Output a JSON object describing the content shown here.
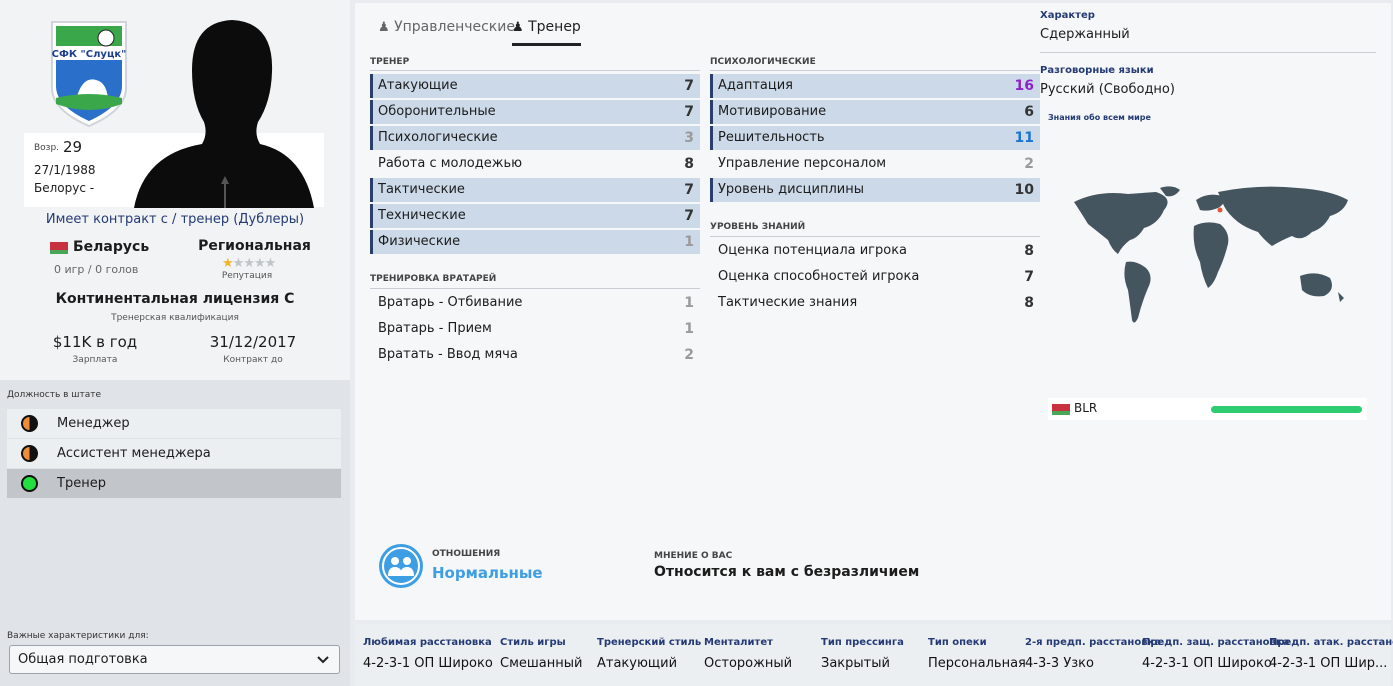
{
  "profile": {
    "age_label": "Возр.",
    "age": "29",
    "dob": "27/1/1988",
    "nationality_text": "Белорус -",
    "contract_prefix": "Имеет контракт с /",
    "contract_role": "тренер (Дублеры)",
    "nation": "Беларусь",
    "games": "0 игр / 0 голов",
    "reputation_value": "Региональная",
    "reputation_label": "Репутация",
    "reputation_stars": 1,
    "reputation_max": 5,
    "license": "Континентальная лицензия С",
    "license_label": "Тренерская квалификация",
    "salary": "$11K в год",
    "salary_label": "Зарплата",
    "contract_end": "31/12/2017",
    "contract_end_label": "Контракт до",
    "club_crest_text": "СФК \"Слуцк\""
  },
  "staff": {
    "title": "Должность в штате",
    "roles": [
      {
        "label": "Менеджер",
        "color": "half"
      },
      {
        "label": "Ассистент менеджера",
        "color": "half"
      },
      {
        "label": "Тренер",
        "color": "#22e040"
      }
    ]
  },
  "key_attr": {
    "label": "Важные характеристики для:",
    "value": "Общая подготовка"
  },
  "tabs": [
    {
      "label": "Управленческие",
      "active": false
    },
    {
      "label": "Тренер",
      "active": true
    }
  ],
  "coach": {
    "title": "ТРЕНЕР",
    "rows": [
      {
        "label": "Атакующие",
        "value": "7",
        "hl": true,
        "cls": "c-norm"
      },
      {
        "label": "Оборонительные",
        "value": "7",
        "hl": true,
        "cls": "c-norm"
      },
      {
        "label": "Психологические",
        "value": "3",
        "hl": true,
        "cls": "c-dim"
      },
      {
        "label": "Работа с молодежью",
        "value": "8",
        "hl": false,
        "cls": "c-norm"
      },
      {
        "label": "Тактические",
        "value": "7",
        "hl": true,
        "cls": "c-norm"
      },
      {
        "label": "Технические",
        "value": "7",
        "hl": true,
        "cls": "c-norm"
      },
      {
        "label": "Физические",
        "value": "1",
        "hl": true,
        "cls": "c-dim"
      }
    ]
  },
  "gk": {
    "title": "ТРЕНИРОВКА ВРАТАРЕЙ",
    "rows": [
      {
        "label": "Вратарь - Отбивание",
        "value": "1",
        "hl": false,
        "cls": "c-dim"
      },
      {
        "label": "Вратарь - Прием",
        "value": "1",
        "hl": false,
        "cls": "c-dim"
      },
      {
        "label": "Вратать - Ввод мяча",
        "value": "2",
        "hl": false,
        "cls": "c-dim"
      }
    ]
  },
  "psych": {
    "title": "ПСИХОЛОГИЧЕСКИЕ",
    "rows": [
      {
        "label": "Адаптация",
        "value": "16",
        "hl": true,
        "cls": "c-purple"
      },
      {
        "label": "Мотивирование",
        "value": "6",
        "hl": true,
        "cls": "c-norm"
      },
      {
        "label": "Решительность",
        "value": "11",
        "hl": true,
        "cls": "c-blue"
      },
      {
        "label": "Управление персоналом",
        "value": "2",
        "hl": false,
        "cls": "c-dim"
      },
      {
        "label": "Уровень дисциплины",
        "value": "10",
        "hl": true,
        "cls": "c-norm"
      }
    ]
  },
  "knowledge": {
    "title": "УРОВЕНЬ ЗНАНИЙ",
    "rows": [
      {
        "label": "Оценка потенциала игрока",
        "value": "8",
        "hl": false,
        "cls": "c-norm"
      },
      {
        "label": "Оценка способностей игрока",
        "value": "7",
        "hl": false,
        "cls": "c-norm"
      },
      {
        "label": "Тактические знания",
        "value": "8",
        "hl": false,
        "cls": "c-norm"
      }
    ]
  },
  "right": {
    "character_label": "Характер",
    "character_value": "Сдержанный",
    "languages_label": "Разговорные языки",
    "languages_value": "Русский (Свободно)",
    "world_label": "Знания обо всем мире",
    "country_code": "BLR",
    "knowledge_level": 1.0
  },
  "relations": {
    "label": "ОТНОШЕНИЯ",
    "value": "Нормальные",
    "opinion_label": "МНЕНИЕ О ВАС",
    "opinion_value": "Относится к вам с безразличием"
  },
  "footer": [
    {
      "title": "Любимая расстановка",
      "value": "4-2-3-1 ОП Широко"
    },
    {
      "title": "Стиль игры",
      "value": "Смешанный"
    },
    {
      "title": "Тренерский стиль",
      "value": "Атакующий"
    },
    {
      "title": "Менталитет",
      "value": "Осторожный"
    },
    {
      "title": "Тип прессинга",
      "value": "Закрытый"
    },
    {
      "title": "Тип опеки",
      "value": "Персональная"
    },
    {
      "title": "2-я предп. расстановка",
      "value": "4-3-3 Узко"
    },
    {
      "title": "Предп. защ. расстановка",
      "value": "4-2-3-1 ОП Широко"
    },
    {
      "title": "Предп. атак. расстано...",
      "value": "4-2-3-1 ОП Шир..."
    }
  ],
  "colors": {
    "highlight_row": "#ccd9e8",
    "accent_navy": "#2c3e6b",
    "knowledge_bar": "#2ecc71",
    "relations_blue": "#3d9ee4"
  }
}
